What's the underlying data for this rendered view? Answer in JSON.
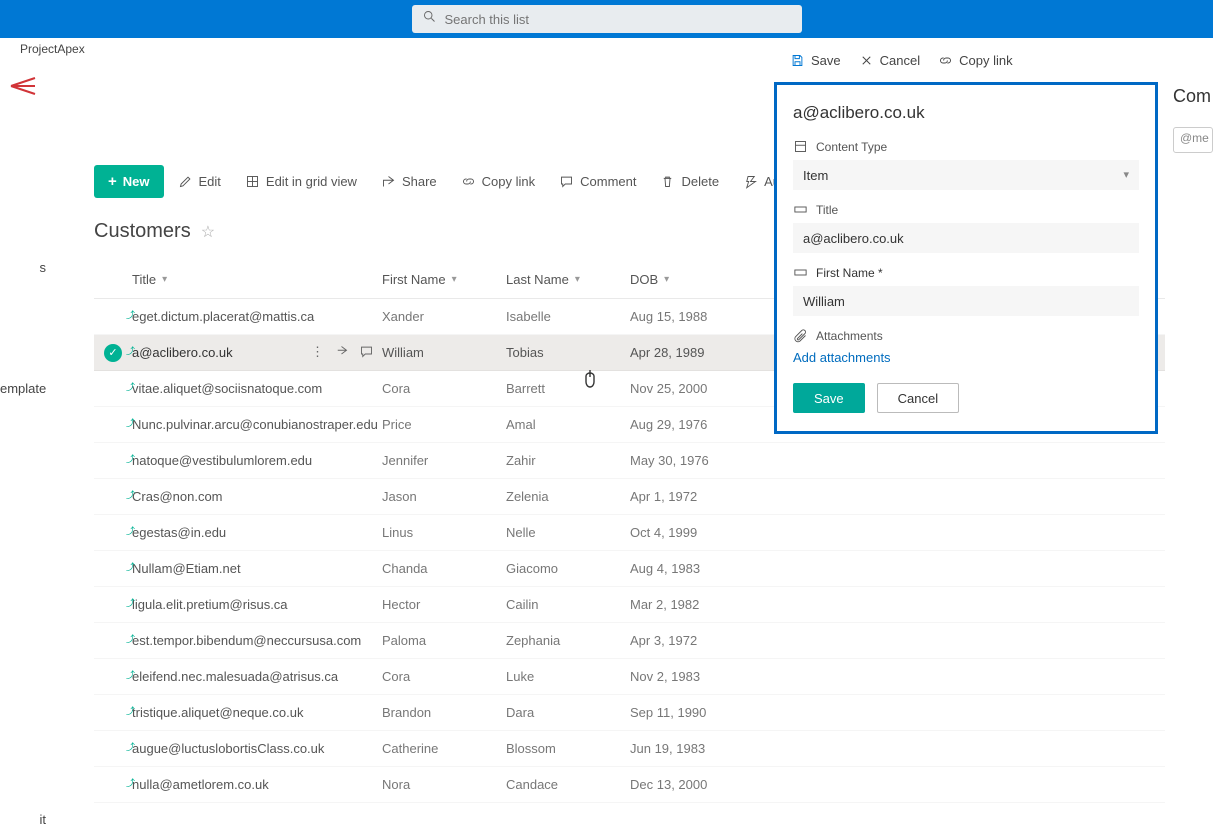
{
  "breadcrumb": "ProjectApex",
  "search": {
    "placeholder": "Search this list"
  },
  "commands": {
    "new": "New",
    "edit": "Edit",
    "gridview": "Edit in grid view",
    "share": "Share",
    "copylink": "Copy link",
    "comment": "Comment",
    "delete": "Delete",
    "automate": "Automate"
  },
  "list": {
    "title": "Customers",
    "columns": {
      "title": "Title",
      "first": "First Name",
      "last": "Last Name",
      "dob": "DOB"
    },
    "rows": [
      {
        "title": "eget.dictum.placerat@mattis.ca",
        "first": "Xander",
        "last": "Isabelle",
        "dob": "Aug 15, 1988"
      },
      {
        "title": "a@aclibero.co.uk",
        "first": "William",
        "last": "Tobias",
        "dob": "Apr 28, 1989",
        "selected": true
      },
      {
        "title": "vitae.aliquet@sociisnatoque.com",
        "first": "Cora",
        "last": "Barrett",
        "dob": "Nov 25, 2000"
      },
      {
        "title": "Nunc.pulvinar.arcu@conubianostraper.edu",
        "first": "Price",
        "last": "Amal",
        "dob": "Aug 29, 1976"
      },
      {
        "title": "natoque@vestibulumlorem.edu",
        "first": "Jennifer",
        "last": "Zahir",
        "dob": "May 30, 1976"
      },
      {
        "title": "Cras@non.com",
        "first": "Jason",
        "last": "Zelenia",
        "dob": "Apr 1, 1972"
      },
      {
        "title": "egestas@in.edu",
        "first": "Linus",
        "last": "Nelle",
        "dob": "Oct 4, 1999"
      },
      {
        "title": "Nullam@Etiam.net",
        "first": "Chanda",
        "last": "Giacomo",
        "dob": "Aug 4, 1983"
      },
      {
        "title": "ligula.elit.pretium@risus.ca",
        "first": "Hector",
        "last": "Cailin",
        "dob": "Mar 2, 1982"
      },
      {
        "title": "est.tempor.bibendum@neccursusa.com",
        "first": "Paloma",
        "last": "Zephania",
        "dob": "Apr 3, 1972"
      },
      {
        "title": "eleifend.nec.malesuada@atrisus.ca",
        "first": "Cora",
        "last": "Luke",
        "dob": "Nov 2, 1983"
      },
      {
        "title": "tristique.aliquet@neque.co.uk",
        "first": "Brandon",
        "last": "Dara",
        "dob": "Sep 11, 1990"
      },
      {
        "title": "augue@luctuslobortisClass.co.uk",
        "first": "Catherine",
        "last": "Blossom",
        "dob": "Jun 19, 1983"
      },
      {
        "title": "nulla@ametlorem.co.uk",
        "first": "Nora",
        "last": "Candace",
        "dob": "Dec 13, 2000"
      }
    ]
  },
  "panelTop": {
    "save": "Save",
    "cancel": "Cancel",
    "copylink": "Copy link"
  },
  "editPanel": {
    "heading": "a@aclibero.co.uk",
    "contentTypeLabel": "Content Type",
    "contentTypeValue": "Item",
    "titleLabel": "Title",
    "titleValue": "a@aclibero.co.uk",
    "firstNameLabel": "First Name *",
    "firstNameValue": "William",
    "attachmentsLabel": "Attachments",
    "addAttachments": "Add attachments",
    "save": "Save",
    "cancel": "Cancel"
  },
  "comments": {
    "title": "Com",
    "placeholder": "@me"
  },
  "leftrail": {
    "item1": "s",
    "item2": "emplate",
    "item3": "it"
  }
}
